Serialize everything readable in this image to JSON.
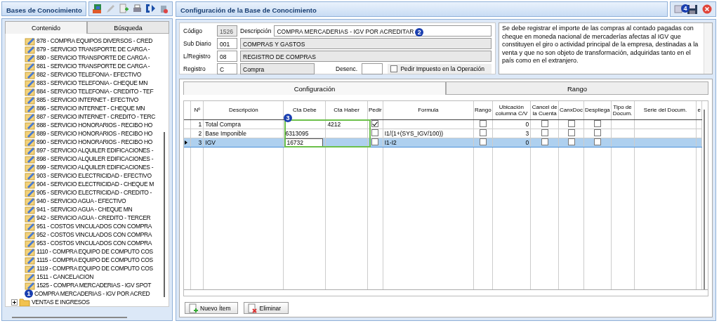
{
  "left_panel": {
    "title": "Bases de Conocimiento",
    "tabs": [
      {
        "label": "Contenido",
        "selected": true
      },
      {
        "label": "Búsqueda",
        "selected": false
      }
    ],
    "tree": [
      {
        "children": [
          {
            "label": "878 - COMPRA EQUIPOS DIVERSOS - CRED"
          },
          {
            "label": "879 - SERVICIO TRANSPORTE DE CARGA -"
          },
          {
            "label": "880 - SERVICIO TRANSPORTE DE CARGA -"
          },
          {
            "label": "881 - SERVICIO TRANSPORTE DE CARGA -"
          },
          {
            "label": "882 - SERVICIO TELEFONIA - EFECTIVO"
          },
          {
            "label": "883 - SERVICIO TELEFONIA - CHEQUE MN"
          },
          {
            "label": "884 - SERVICIO TELEFONIA - CREDITO - TEF"
          },
          {
            "label": "885 - SERVICIO INTERNET - EFECTIVO"
          },
          {
            "label": "886 - SERVICIO INTERNET - CHEQUE MN"
          },
          {
            "label": "887 - SERVICIO INTERNET - CREDITO - TERC"
          },
          {
            "label": "888 - SERVICIO HONORARIOS - RECIBO HO"
          },
          {
            "label": "889 - SERVICIO HONORARIOS - RECIBO HO"
          },
          {
            "label": "890 - SERVICIO HONORARIOS - RECIBO HO"
          },
          {
            "label": "897 - SERVICIO ALQUILER EDIFICACIONES -"
          },
          {
            "label": "898 - SERVICIO ALQUILER EDIFICACIONES -"
          },
          {
            "label": "899 - SERVICIO ALQUILER EDIFICACIONES -"
          },
          {
            "label": "903 - SERVICIO ELECTRICIDAD - EFECTIVO"
          },
          {
            "label": "904 - SERVICIO ELECTRICIDAD - CHEQUE M"
          },
          {
            "label": "905 - SERVICIO ELECTRICIDAD - CREDITO -"
          },
          {
            "label": "940 - SERVICIO AGUA - EFECTIVO"
          },
          {
            "label": "941 - SERVICIO AGUA - CHEQUE MN"
          },
          {
            "label": "942 - SERVICIO AGUA - CREDITO - TERCER"
          },
          {
            "label": "951 - COSTOS VINCULADOS CON COMPRA"
          },
          {
            "label": "952 - COSTOS VINCULADOS CON COMPRA"
          },
          {
            "label": "953 - COSTOS VINCULADOS CON COMPRA"
          },
          {
            "label": "1110 - COMPRA EQUIPO DE COMPUTO COS"
          },
          {
            "label": "1115 - COMPRA EQUIPO DE COMPUTO COS"
          },
          {
            "label": "1119 - COMPRA EQUIPO DE COMPUTO COS"
          },
          {
            "label": "1511 - CANCELACION"
          },
          {
            "label": "1525 - COMPRA MERCADERIAS - IGV SPOT"
          },
          {
            "label": "COMPRA MERCADERIAS - IGV POR ACRED",
            "badge": "1"
          }
        ]
      },
      {
        "label": "VENTAS E INGRESOS",
        "expanded": false
      }
    ]
  },
  "right_panel": {
    "title": "Configuración de la Base de Conocimiento",
    "toolbar_badge": "4",
    "form": {
      "codigo": {
        "label": "Código",
        "value": "1526"
      },
      "descripcion": {
        "label": "Descripción",
        "value": "COMPRA MERCADERIAS - IGV POR ACREDITAR",
        "badge": "2"
      },
      "sub_diario": {
        "label": "Sub Diario",
        "value": "001",
        "name": "COMPRAS Y GASTOS"
      },
      "l_registro": {
        "label": "L/Registro",
        "value": "08",
        "name": "REGISTRO DE COMPRAS"
      },
      "registro": {
        "label": "Registro",
        "value": "C",
        "name": "Compra"
      },
      "desenc": {
        "label": "Desenc."
      },
      "pedir_impuesto": {
        "label": "Pedir Impuesto en la Operación",
        "checked": false
      }
    },
    "note": "Se debe registrar el importe de las compras al contado pagadas con cheque en moneda nacional de mercaderías afectas al IGV que constituyen el giro o actividad principal de la empresa, destinadas a la venta y que no son objeto de transformación, adquiridas tanto en el país como en el extranjero.",
    "tabs": [
      {
        "label": "Configuración",
        "selected": true
      },
      {
        "label": "Rango",
        "selected": false
      }
    ],
    "grid": {
      "highlight_badge": "3",
      "columns": [
        {
          "label": "Nº",
          "kind": "num"
        },
        {
          "label": "Descripción",
          "kind": "text"
        },
        {
          "label": "Cta Debe",
          "kind": "text"
        },
        {
          "label": "Cta Haber",
          "kind": "text"
        },
        {
          "label": "Pedir",
          "kind": "check"
        },
        {
          "label": "Formula",
          "kind": "text"
        },
        {
          "label": "Rango",
          "kind": "check"
        },
        {
          "label": "Ubicación columna C/V",
          "kind": "num"
        },
        {
          "label": "Cancel de la Cuenta",
          "kind": "check"
        },
        {
          "label": "CanxDoc",
          "kind": "check"
        },
        {
          "label": "Despliega",
          "kind": "check"
        },
        {
          "label": "Tipo de Docum.",
          "kind": "text"
        },
        {
          "label": "Serie del Docum.",
          "kind": "text"
        },
        {
          "label": "e",
          "kind": "text"
        }
      ],
      "rows": [
        {
          "selected": false,
          "cells": [
            "1",
            "Total Compra",
            "",
            "4212",
            {
              "checked": true
            },
            "",
            {
              "checked": false
            },
            "0",
            {
              "checked": false
            },
            {
              "checked": false
            },
            {
              "checked": false
            },
            "",
            "",
            ""
          ]
        },
        {
          "selected": false,
          "cells": [
            "2",
            "Base Imponible",
            "6313095",
            "",
            {
              "checked": false
            },
            "I1/(1+(SYS_IGV/100))",
            {
              "checked": false
            },
            "3",
            {
              "checked": false
            },
            {
              "checked": false
            },
            {
              "checked": false
            },
            "",
            "",
            ""
          ]
        },
        {
          "selected": true,
          "cells": [
            "3",
            "IGV",
            {
              "text": "16732",
              "editing": true
            },
            "",
            {
              "checked": false
            },
            "I1-I2",
            {
              "checked": false
            },
            "0",
            {
              "checked": false
            },
            {
              "checked": false
            },
            {
              "checked": false
            },
            "",
            "",
            ""
          ]
        }
      ]
    },
    "buttons": [
      {
        "label": "Nuevo Ítem",
        "kind": "new"
      },
      {
        "label": "Eliminar",
        "kind": "delete"
      }
    ]
  }
}
